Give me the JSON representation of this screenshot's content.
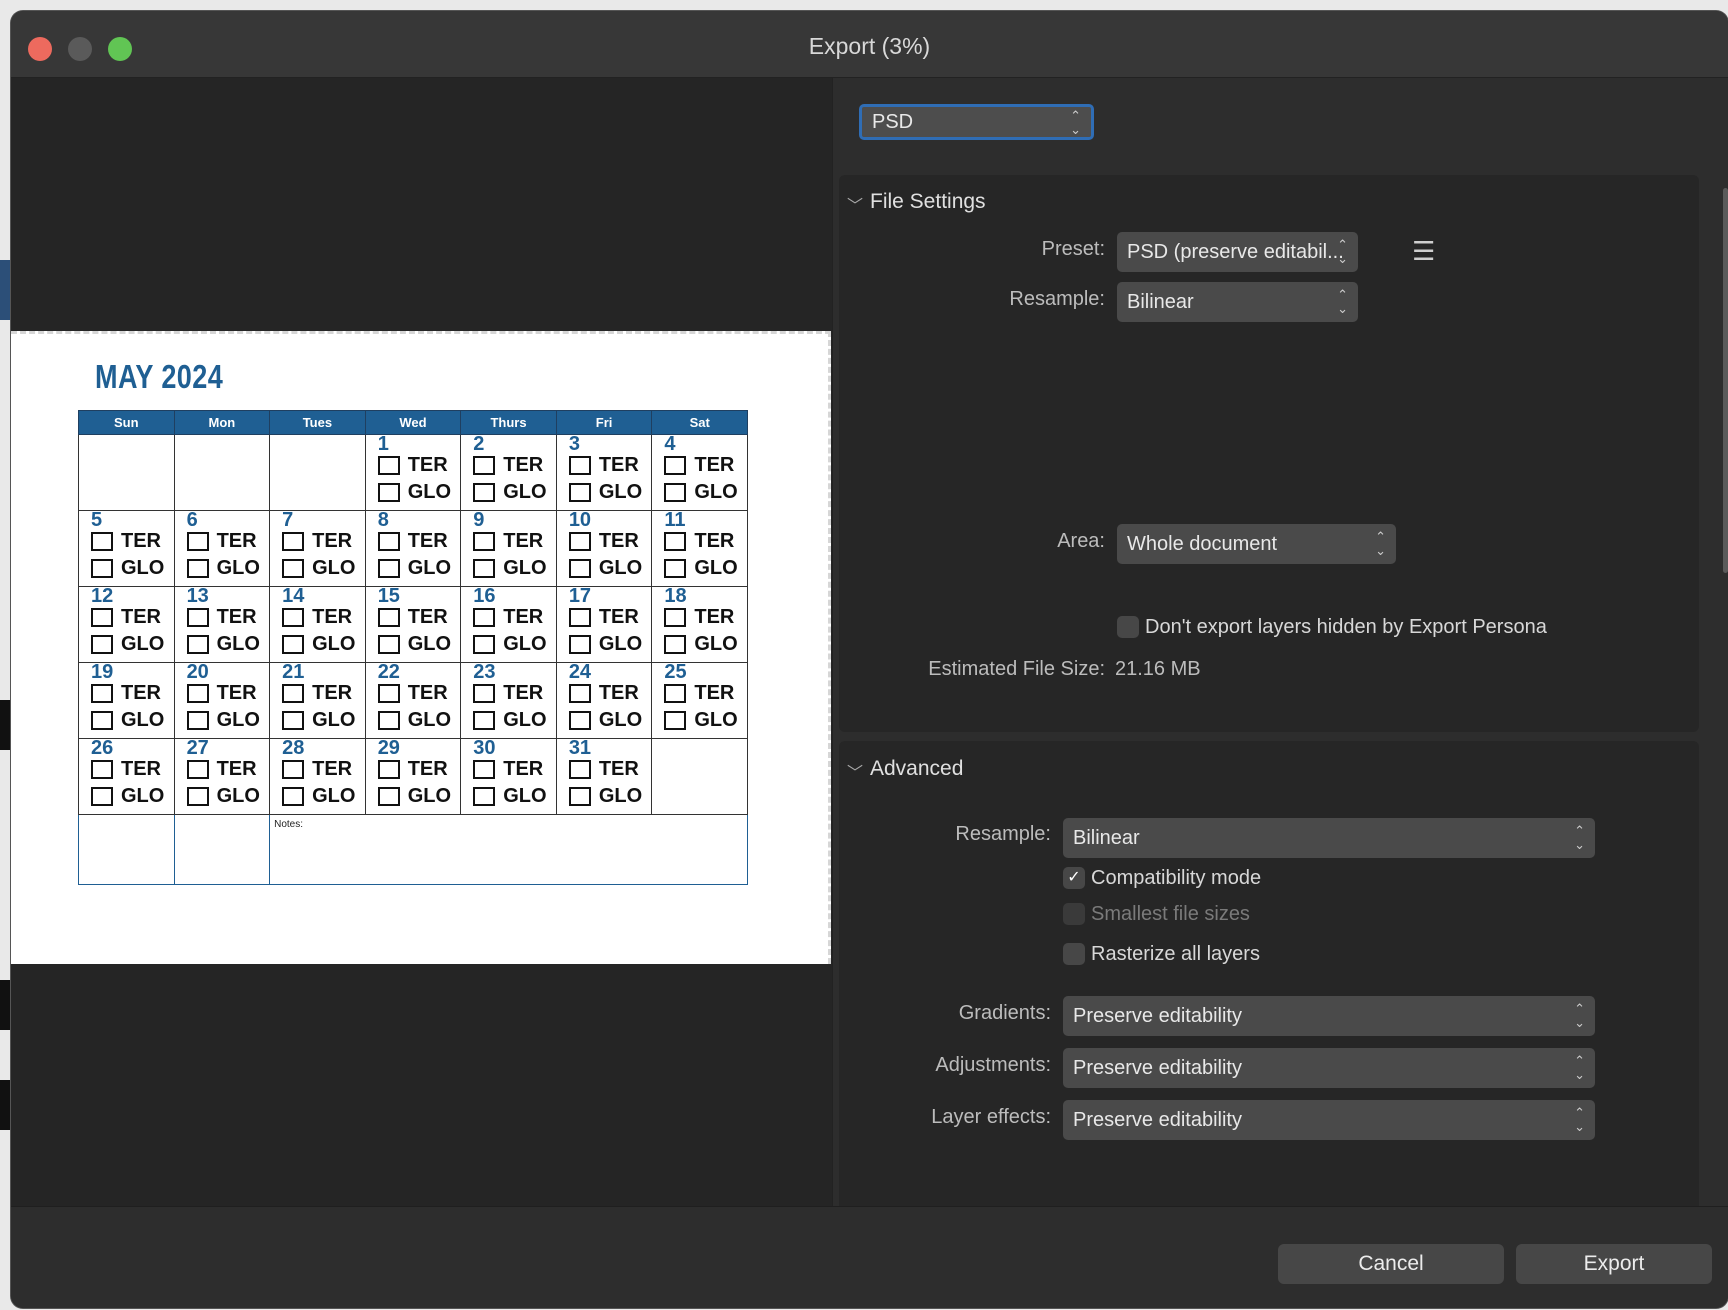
{
  "window": {
    "title": "Export (3%)"
  },
  "format": {
    "value": "PSD"
  },
  "preview": {
    "calendar": {
      "title": "MAY 2024",
      "weekdays": [
        "Sun",
        "Mon",
        "Tues",
        "Wed",
        "Thurs",
        "Fri",
        "Sat"
      ],
      "option_a": "TER",
      "option_b": "GLO",
      "weeks": [
        [
          "",
          "",
          "",
          "1",
          "2",
          "3",
          "4"
        ],
        [
          "5",
          "6",
          "7",
          "8",
          "9",
          "10",
          "11"
        ],
        [
          "12",
          "13",
          "14",
          "15",
          "16",
          "17",
          "18"
        ],
        [
          "19",
          "20",
          "21",
          "22",
          "23",
          "24",
          "25"
        ],
        [
          "26",
          "27",
          "28",
          "29",
          "30",
          "31",
          ""
        ]
      ],
      "notes_label": "Notes:"
    }
  },
  "file_settings": {
    "heading": "File Settings",
    "preset_label": "Preset:",
    "preset_value": "PSD (preserve editabil...",
    "resample_label": "Resample:",
    "resample_value": "Bilinear",
    "area_label": "Area:",
    "area_value": "Whole document",
    "hidden_layers_label": "Don't export layers hidden by Export Persona",
    "hidden_layers_checked": false,
    "file_size_label": "Estimated File Size:",
    "file_size_value": "21.16 MB"
  },
  "advanced": {
    "heading": "Advanced",
    "resample_label": "Resample:",
    "resample_value": "Bilinear",
    "compat_label": "Compatibility mode",
    "compat_checked": true,
    "smallest_label": "Smallest file sizes",
    "smallest_checked": false,
    "rasterize_label": "Rasterize all layers",
    "rasterize_checked": false,
    "gradients_label": "Gradients:",
    "gradients_value": "Preserve editability",
    "adjustments_label": "Adjustments:",
    "adjustments_value": "Preserve editability",
    "effects_label": "Layer effects:",
    "effects_value": "Preserve editability"
  },
  "buttons": {
    "cancel": "Cancel",
    "export": "Export"
  },
  "colors": {
    "close": "#ed6a5e",
    "minimize": "#5a5a5a",
    "zoom": "#61c554",
    "accent": "#2f6db5",
    "calendar_blue": "#1f5f93"
  }
}
